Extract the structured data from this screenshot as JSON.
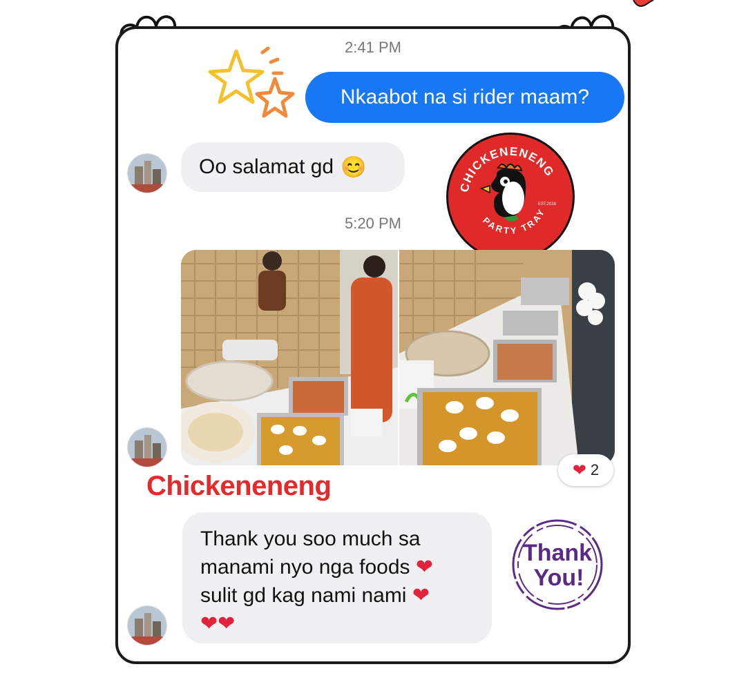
{
  "messages": [
    {
      "time": "2:41 PM"
    },
    {
      "outgoing": "Nkaabot na si rider maam?"
    },
    {
      "incoming": "Oo salamat gd",
      "emoji": "😊"
    },
    {
      "time": "5:20 PM"
    },
    {
      "reaction_count": "2"
    },
    {
      "incoming_lines": [
        "Thank you soo much sa",
        "manami nyo nga foods",
        "sulit gd kag nami nami"
      ]
    }
  ],
  "brand": {
    "name": "Chickeneneng",
    "logo_top_text": "CHICKENENENG",
    "logo_bottom_text": "PARTY TRAYS",
    "logo_est": "EST.2018"
  },
  "thank_you_badge": {
    "line1": "Thank",
    "line2": "You!"
  },
  "colors": {
    "outgoing_bubble": "#1877f2",
    "incoming_bubble": "#f0f0f2",
    "brand_red": "#e42a2a",
    "badge_purple": "#5b2a86"
  },
  "icons": [
    "star-doodle-icon",
    "heart-icon",
    "smile-emoji-icon"
  ]
}
